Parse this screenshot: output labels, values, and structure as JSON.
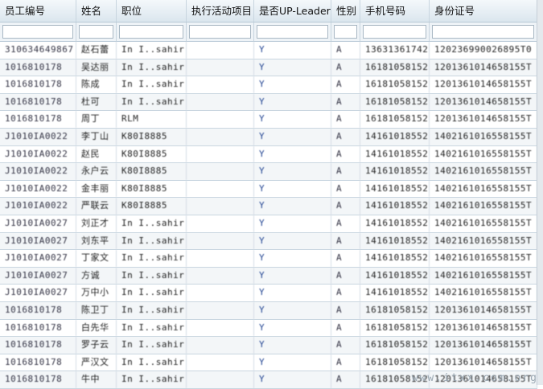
{
  "columns": [
    "员工编号",
    "姓名",
    "职位",
    "执行活动项目",
    "是否UP-Leader",
    "性别",
    "手机号码",
    "身份证号"
  ],
  "rows": [
    [
      "310634649867",
      "赵石蕾",
      "In I..sahir",
      "",
      "Y",
      "A",
      "13631361742",
      "120236990026895T0"
    ],
    [
      "1016810178",
      "吴达丽",
      "In I..sahir",
      "",
      "Y",
      "A",
      "16181058152",
      "1201361014658155T"
    ],
    [
      "1016810178",
      "陈成",
      "In I..sahir",
      "",
      "Y",
      "A",
      "16181058152",
      "1201361014658155T"
    ],
    [
      "1016810178",
      "杜可",
      "In I..sahir",
      "",
      "Y",
      "A",
      "16181058152",
      "1201361014658155T"
    ],
    [
      "1016810178",
      "周丁",
      "RLM",
      "",
      "Y",
      "A",
      "16181058152",
      "1201361014658155T"
    ],
    [
      "J1010IA0022",
      "李丁山",
      "K80I8885",
      "",
      "Y",
      "A",
      "14161018552",
      "1402161016558155T"
    ],
    [
      "J1010IA0022",
      "赵民",
      "K80I8885",
      "",
      "Y",
      "A",
      "14161018552",
      "1402161016558155T"
    ],
    [
      "J1010IA0022",
      "永户云",
      "K80I8885",
      "",
      "Y",
      "A",
      "14161018552",
      "1402161016558155T"
    ],
    [
      "J1010IA0022",
      "金丰丽",
      "K80I8885",
      "",
      "Y",
      "A",
      "14161018552",
      "1402161016558155T"
    ],
    [
      "J1010IA0022",
      "严联云",
      "K80I8885",
      "",
      "Y",
      "A",
      "14161018552",
      "1402161016558155T"
    ],
    [
      "J1010IA0027",
      "刘正才",
      "In I..sahir",
      "",
      "Y",
      "A",
      "14161018552",
      "1402161016558155T"
    ],
    [
      "J1010IA0027",
      "刘东平",
      "In I..sahir",
      "",
      "Y",
      "A",
      "14161018552",
      "1402161016558155T"
    ],
    [
      "J1010IA0027",
      "丁家文",
      "In I..sahir",
      "",
      "Y",
      "A",
      "14161018552",
      "1402161016558155T"
    ],
    [
      "J1010IA0027",
      "方诚",
      "In I..sahir",
      "",
      "Y",
      "A",
      "14161018552",
      "1402161016558155T"
    ],
    [
      "J1010IA0027",
      "万中小",
      "In I..sahir",
      "",
      "Y",
      "A",
      "14161018552",
      "1402161016558155T"
    ],
    [
      "1016810178",
      "陈卫丁",
      "In I..sahir",
      "",
      "Y",
      "A",
      "16181058152",
      "1201361014658155T"
    ],
    [
      "1016810178",
      "白先华",
      "In I..sahir",
      "",
      "Y",
      "A",
      "16181058152",
      "1201361014658155T"
    ],
    [
      "1016810178",
      "罗子云",
      "In I..sahir",
      "",
      "Y",
      "A",
      "16181058152",
      "1201361014658155T"
    ],
    [
      "1016810178",
      "严汉文",
      "In I..sahir",
      "",
      "Y",
      "A",
      "16181058152",
      "1201361014658155T"
    ],
    [
      "1016810178",
      "牛中",
      "In I..sahir",
      "",
      "Y",
      "A",
      "16181058152",
      "1201361014658155T"
    ]
  ],
  "watermark": "www.itxx.com.org"
}
